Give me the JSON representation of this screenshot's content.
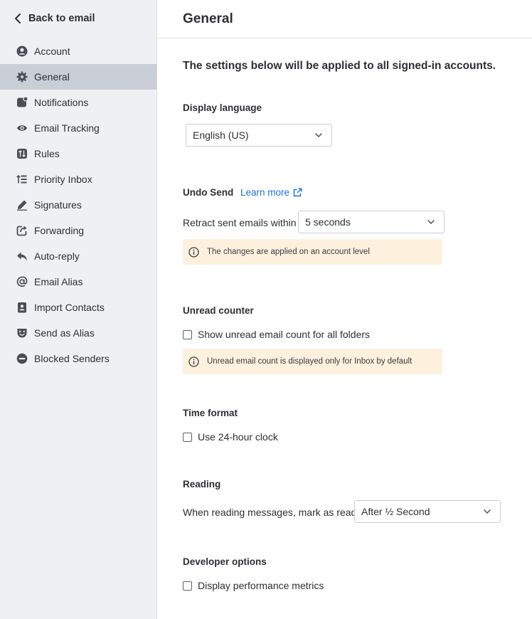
{
  "sidebar": {
    "back_label": "Back to email",
    "items": [
      {
        "label": "Account",
        "icon": "account-icon"
      },
      {
        "label": "General",
        "icon": "gear-icon",
        "active": true
      },
      {
        "label": "Notifications",
        "icon": "notifications-icon"
      },
      {
        "label": "Email Tracking",
        "icon": "eye-icon"
      },
      {
        "label": "Rules",
        "icon": "rules-icon"
      },
      {
        "label": "Priority Inbox",
        "icon": "priority-icon"
      },
      {
        "label": "Signatures",
        "icon": "pen-icon"
      },
      {
        "label": "Forwarding",
        "icon": "forward-icon"
      },
      {
        "label": "Auto-reply",
        "icon": "reply-icon"
      },
      {
        "label": "Email Alias",
        "icon": "at-icon"
      },
      {
        "label": "Import Contacts",
        "icon": "contacts-icon"
      },
      {
        "label": "Send as Alias",
        "icon": "mask-icon"
      },
      {
        "label": "Blocked Senders",
        "icon": "blocked-icon"
      }
    ]
  },
  "main": {
    "title": "General",
    "intro": "The settings below will be applied to all signed-in accounts.",
    "display_language": {
      "title": "Display language",
      "value": "English (US)"
    },
    "undo_send": {
      "title": "Undo Send",
      "learn_more": "Learn more",
      "label": "Retract sent emails within",
      "value": "5 seconds",
      "notice": "The changes are applied on an account level"
    },
    "unread_counter": {
      "title": "Unread counter",
      "checkbox_label": "Show unread email count for all folders",
      "checked": false,
      "notice": "Unread email count is displayed only for Inbox by default"
    },
    "time_format": {
      "title": "Time format",
      "checkbox_label": "Use 24-hour clock",
      "checked": false
    },
    "reading": {
      "title": "Reading",
      "label": "When reading messages, mark as read",
      "value": "After ½ Second"
    },
    "developer_options": {
      "title": "Developer options",
      "checkbox_label": "Display performance metrics",
      "checked": false
    }
  },
  "colors": {
    "sidebar_bg": "#eff0f3",
    "active_item_bg": "#c9ced7",
    "link": "#1f72d6",
    "notice_bg": "#fdf0dd"
  }
}
